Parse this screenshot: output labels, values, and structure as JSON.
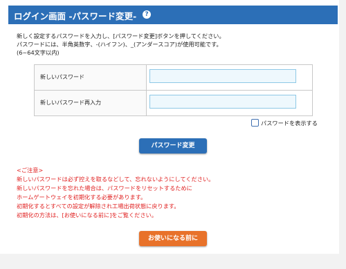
{
  "header": {
    "title": "ログイン画面 -パスワード変更-",
    "help_icon": "question-circle-icon",
    "help_glyph": "?"
  },
  "intro": {
    "line1": "新しく設定するパスワードを入力し、[パスワード変更]ボタンを押してください。",
    "line2": "パスワードには、半角英数字、-(ハイフン)、_(アンダースコア)が使用可能です。",
    "line3": "(6~64文字以内)"
  },
  "form": {
    "new_password_label": "新しいパスワード",
    "new_password_value": "",
    "confirm_password_label": "新しいパスワード再入力",
    "confirm_password_value": "",
    "show_password_label": "パスワードを表示する",
    "show_password_checked": false
  },
  "buttons": {
    "change_password": "パスワード変更",
    "before_use": "お使いになる前に"
  },
  "notice": {
    "heading": "<ご注意>",
    "lines": [
      "新しいパスワードは必ず控えを取るなどして、忘れないようにしてください。",
      "新しいパスワードを忘れた場合は、パスワードをリセットするために",
      "ホームゲートウェイを初期化する必要があります。",
      "初期化するとすべての設定が解除され工場出荷状態に戻ります。",
      "初期化の方法は、[お使いになる前に]をご覧ください。"
    ]
  },
  "colors": {
    "header_bg": "#2c6fb7",
    "button_blue": "#2c6fb7",
    "button_orange": "#e8722a",
    "notice_text": "#e02020"
  }
}
